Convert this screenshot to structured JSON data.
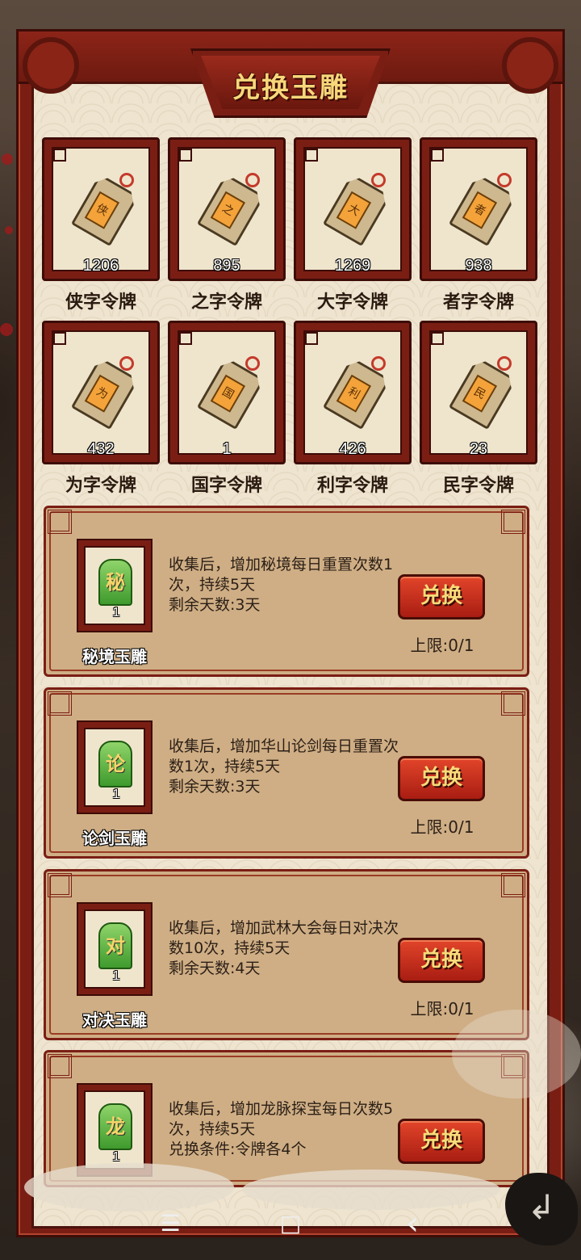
{
  "title": "兑换玉雕",
  "tokens": [
    {
      "glyph": "侠",
      "count": "1206",
      "name": "侠字令牌"
    },
    {
      "glyph": "之",
      "count": "895",
      "name": "之字令牌"
    },
    {
      "glyph": "大",
      "count": "1269",
      "name": "大字令牌"
    },
    {
      "glyph": "者",
      "count": "938",
      "name": "者字令牌"
    },
    {
      "glyph": "为",
      "count": "432",
      "name": "为字令牌"
    },
    {
      "glyph": "国",
      "count": "1",
      "name": "国字令牌"
    },
    {
      "glyph": "利",
      "count": "426",
      "name": "利字令牌"
    },
    {
      "glyph": "民",
      "count": "23",
      "name": "民字令牌"
    }
  ],
  "exchanges": [
    {
      "glyph": "秘",
      "count": "1",
      "name": "秘境玉雕",
      "desc": "收集后，增加秘境每日重置次数1次，持续5天",
      "remain": "剩余天数:3天",
      "button": "兑换",
      "limit": "上限:0/1"
    },
    {
      "glyph": "论",
      "count": "1",
      "name": "论剑玉雕",
      "desc": "收集后，增加华山论剑每日重置次数1次，持续5天",
      "remain": "剩余天数:3天",
      "button": "兑换",
      "limit": "上限:0/1"
    },
    {
      "glyph": "对",
      "count": "1",
      "name": "对决玉雕",
      "desc": "收集后，增加武林大会每日对决次数10次，持续5天",
      "remain": "剩余天数:4天",
      "button": "兑换",
      "limit": "上限:0/1"
    },
    {
      "glyph": "龙",
      "count": "1",
      "name": "",
      "desc": "收集后，增加龙脉探宝每日次数5次，持续5天",
      "remain": "兑换条件:令牌各4个",
      "button": "兑换",
      "limit": ""
    }
  ],
  "nav": {
    "menu_icon": "☰",
    "home_icon": "□",
    "back_icon": "‹"
  },
  "back_button_icon": "↲"
}
